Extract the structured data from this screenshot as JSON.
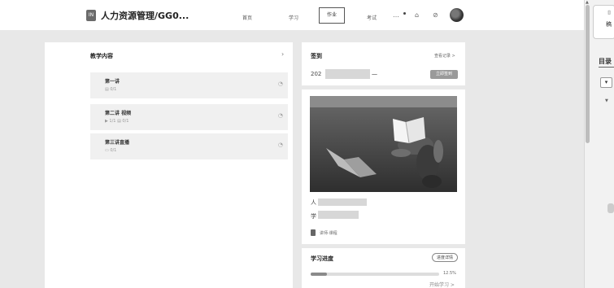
{
  "header": {
    "logo_text": "IN",
    "title": "人力资源管理/GG0...",
    "tabs": [
      {
        "label": "首页"
      },
      {
        "label": "学习"
      },
      {
        "label": "作业"
      },
      {
        "label": "考试"
      }
    ],
    "active_tab_index": 2,
    "icons": [
      "more-icon",
      "bell-icon",
      "help-icon",
      "avatar"
    ]
  },
  "main": {
    "title": "教学内容",
    "lessons": [
      {
        "title": "第一讲",
        "meta": "▤ 0/1"
      },
      {
        "title": "第二讲 视频",
        "meta": "▶ 1/1  ▤ 0/1"
      },
      {
        "title": "第三讲直播",
        "meta": "▭ 0/1"
      }
    ]
  },
  "sign": {
    "title": "签到",
    "link": "查看记录 >",
    "date": "202",
    "date_end": "一",
    "button": "立即签到"
  },
  "course": {
    "name_prefix": "人",
    "meta_prefix": "学",
    "lecturer": "讲师·课程"
  },
  "progress": {
    "title": "学习进度",
    "button": "进度详情",
    "percent_text": "12.5%",
    "value": 0.125,
    "start": "开始学习 >"
  },
  "right_panel": {
    "heading": "目录",
    "card_text": "稿",
    "button": "▾"
  }
}
